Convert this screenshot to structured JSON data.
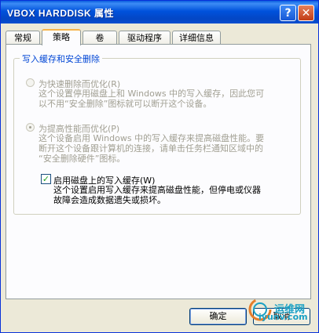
{
  "window": {
    "title": "VBOX HARDDISK 属性",
    "help_label": "?",
    "close_label": "✕"
  },
  "tabs": [
    {
      "label": "常规",
      "active": false
    },
    {
      "label": "策略",
      "active": true
    },
    {
      "label": "卷",
      "active": false
    },
    {
      "label": "驱动程序",
      "active": false
    },
    {
      "label": "详细信息",
      "active": false
    }
  ],
  "group": {
    "legend": "写入缓存和安全删除",
    "options": [
      {
        "label": "为快速删除而优化(R)",
        "description": "这个设置停用磁盘上和 Windows 中的写入缓存，因此您可\n以不用“安全删除”图标就可以断开这个设备。",
        "selected": false,
        "enabled": false
      },
      {
        "label": "为提高性能而优化(P)",
        "description": "这个设备启用 Windows 中的写入缓存来提高磁盘性能。要\n断开这个设备跟计算机的连接，请单击任务栏通知区域中的\n“安全删除硬件”图标。",
        "selected": true,
        "enabled": false
      }
    ],
    "checkbox": {
      "label": "启用磁盘上的写入缓存(W)",
      "checked": true,
      "description": "这个设置启用写入缓存来提高磁盘性能，但停电或仪器\n故障会造成数据遗失或损坏。"
    }
  },
  "buttons": {
    "ok": "确定",
    "cancel": "取消"
  },
  "watermark": {
    "name_cn": "运维网",
    "name_en": "iyunv.com"
  },
  "colors": {
    "titlebar": "#0052dc",
    "legend": "#0046d5",
    "disabled_text": "#a19f92",
    "active_tab_accent": "#f7b34a",
    "watermark": "#1aa0c4"
  }
}
